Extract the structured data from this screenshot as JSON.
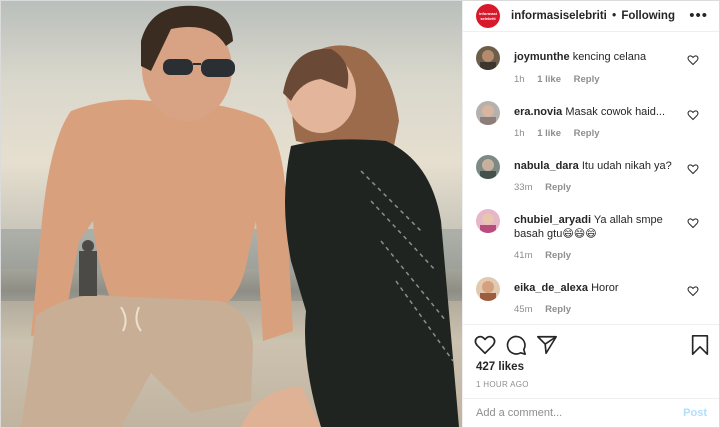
{
  "header": {
    "username": "informasiselebriti",
    "separator": "•",
    "follow_state": "Following",
    "brand_logo_text": "informasi selebriti",
    "more_icon": "more-horizontal-icon"
  },
  "comments": [
    {
      "user": "joymunthe",
      "text": "kencing celana",
      "time": "1h",
      "likes": "1 like",
      "reply": "Reply"
    },
    {
      "user": "era.novia",
      "text": "Masak cowok haid...",
      "time": "1h",
      "likes": "1 like",
      "reply": "Reply"
    },
    {
      "user": "nabula_dara",
      "text": "Itu udah nikah ya?",
      "time": "33m",
      "likes": "",
      "reply": "Reply"
    },
    {
      "user": "chubiel_aryadi",
      "text": "Ya allah smpe basah gtu😄😄😄",
      "time": "41m",
      "likes": "",
      "reply": "Reply"
    },
    {
      "user": "eika_de_alexa",
      "text": "Horor",
      "time": "45m",
      "likes": "",
      "reply": "Reply"
    }
  ],
  "actions": {
    "icons": [
      "heart-icon",
      "comment-icon",
      "share-icon",
      "bookmark-icon"
    ],
    "likes": "427 likes",
    "timestamp": "1 HOUR AGO"
  },
  "add_comment": {
    "placeholder": "Add a comment...",
    "post_label": "Post"
  },
  "colors": {
    "brand": "#d7192b",
    "text": "#262626",
    "muted": "#8e8e8e",
    "post_disabled": "#b2dffc"
  }
}
